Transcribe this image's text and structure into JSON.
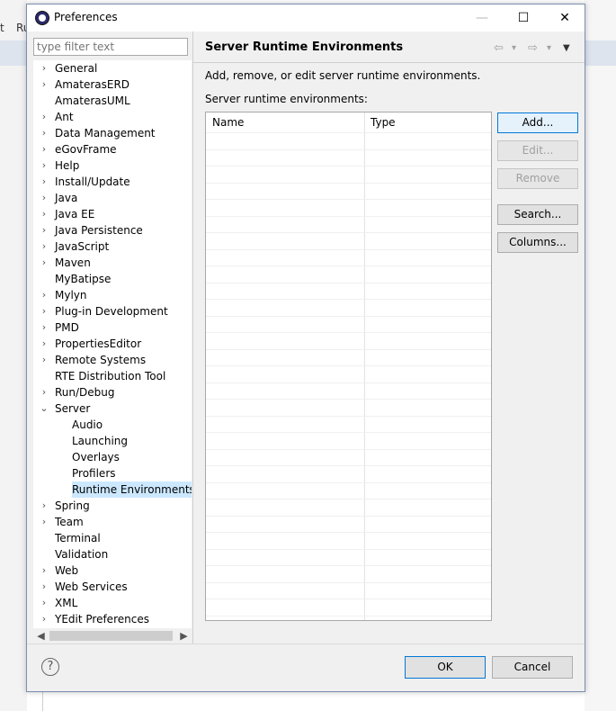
{
  "background": {
    "left_fragment_1": "t",
    "left_fragment_2": "Ru"
  },
  "window": {
    "title": "Preferences",
    "minimize_glyph": "—",
    "maximize_glyph": "☐",
    "close_glyph": "✕"
  },
  "filter": {
    "placeholder": "type filter text"
  },
  "tree": {
    "items": [
      {
        "label": "General",
        "has_children": true
      },
      {
        "label": "AmaterasERD",
        "has_children": true
      },
      {
        "label": "AmaterasUML",
        "has_children": false
      },
      {
        "label": "Ant",
        "has_children": true
      },
      {
        "label": "Data Management",
        "has_children": true
      },
      {
        "label": "eGovFrame",
        "has_children": true
      },
      {
        "label": "Help",
        "has_children": true
      },
      {
        "label": "Install/Update",
        "has_children": true
      },
      {
        "label": "Java",
        "has_children": true
      },
      {
        "label": "Java EE",
        "has_children": true
      },
      {
        "label": "Java Persistence",
        "has_children": true
      },
      {
        "label": "JavaScript",
        "has_children": true
      },
      {
        "label": "Maven",
        "has_children": true
      },
      {
        "label": "MyBatipse",
        "has_children": false
      },
      {
        "label": "Mylyn",
        "has_children": true
      },
      {
        "label": "Plug-in Development",
        "has_children": true
      },
      {
        "label": "PMD",
        "has_children": true
      },
      {
        "label": "PropertiesEditor",
        "has_children": true
      },
      {
        "label": "Remote Systems",
        "has_children": true
      },
      {
        "label": "RTE Distribution Tool",
        "has_children": false
      },
      {
        "label": "Run/Debug",
        "has_children": true
      },
      {
        "label": "Server",
        "has_children": true,
        "expanded": true
      },
      {
        "label": "Audio",
        "child": true
      },
      {
        "label": "Launching",
        "child": true
      },
      {
        "label": "Overlays",
        "child": true
      },
      {
        "label": "Profilers",
        "child": true
      },
      {
        "label": "Runtime Environments",
        "child": true,
        "selected": true
      },
      {
        "label": "Spring",
        "has_children": true
      },
      {
        "label": "Team",
        "has_children": true
      },
      {
        "label": "Terminal",
        "has_children": false
      },
      {
        "label": "Validation",
        "has_children": false
      },
      {
        "label": "Web",
        "has_children": true
      },
      {
        "label": "Web Services",
        "has_children": true
      },
      {
        "label": "XML",
        "has_children": true
      },
      {
        "label": "YEdit Preferences",
        "has_children": true
      }
    ],
    "collapsed_glyph": "›",
    "expanded_glyph": "⌄"
  },
  "page": {
    "title": "Server Runtime Environments",
    "description": "Add, remove, or edit server runtime environments.",
    "list_label": "Server runtime environments:",
    "columns": [
      "Name",
      "Type"
    ],
    "nav": {
      "back": "⇦",
      "forward": "⇨",
      "dropdown": "▾",
      "menu": "▼"
    }
  },
  "buttons": {
    "add": "Add...",
    "edit": "Edit...",
    "remove": "Remove",
    "search": "Search...",
    "columns": "Columns..."
  },
  "footer": {
    "help": "?",
    "ok": "OK",
    "cancel": "Cancel"
  },
  "colors": {
    "selection": "#cce8ff",
    "accent": "#0078d7"
  }
}
